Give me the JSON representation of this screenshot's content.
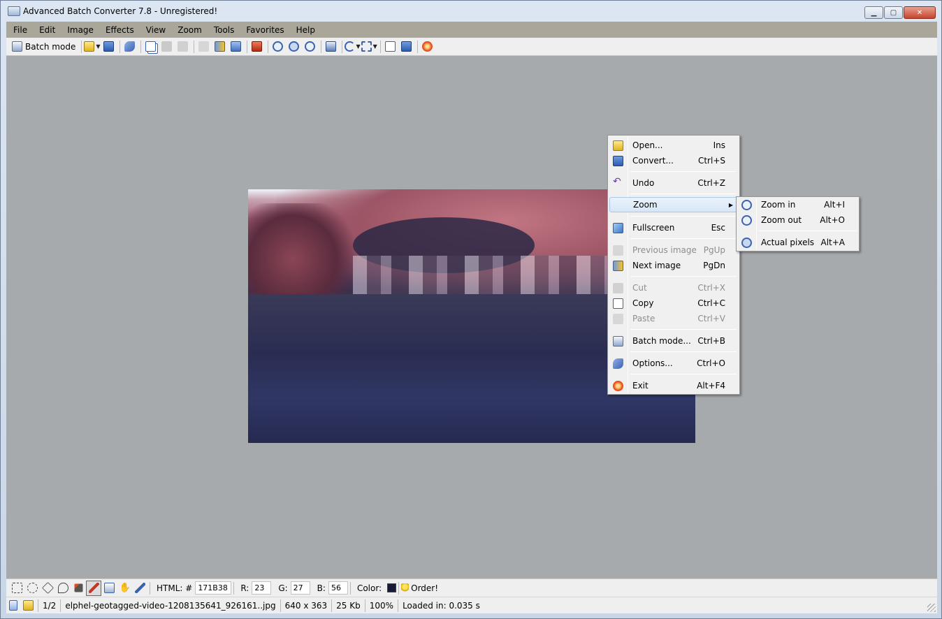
{
  "window": {
    "title": "Advanced Batch Converter 7.8 - Unregistered!"
  },
  "menubar": [
    "File",
    "Edit",
    "Image",
    "Effects",
    "View",
    "Zoom",
    "Tools",
    "Favorites",
    "Help"
  ],
  "toolbar": {
    "batch_label": "Batch mode"
  },
  "context_menu": {
    "items": [
      {
        "label": "Open...",
        "shortcut": "Ins"
      },
      {
        "label": "Convert...",
        "shortcut": "Ctrl+S"
      },
      {
        "label": "Undo",
        "shortcut": "Ctrl+Z"
      },
      {
        "label": "Zoom",
        "shortcut": ""
      },
      {
        "label": "Fullscreen",
        "shortcut": "Esc"
      },
      {
        "label": "Previous image",
        "shortcut": "PgUp"
      },
      {
        "label": "Next image",
        "shortcut": "PgDn"
      },
      {
        "label": "Cut",
        "shortcut": "Ctrl+X"
      },
      {
        "label": "Copy",
        "shortcut": "Ctrl+C"
      },
      {
        "label": "Paste",
        "shortcut": "Ctrl+V"
      },
      {
        "label": "Batch mode...",
        "shortcut": "Ctrl+B"
      },
      {
        "label": "Options...",
        "shortcut": "Ctrl+O"
      },
      {
        "label": "Exit",
        "shortcut": "Alt+F4"
      }
    ]
  },
  "zoom_submenu": {
    "items": [
      {
        "label": "Zoom in",
        "shortcut": "Alt+I"
      },
      {
        "label": "Zoom out",
        "shortcut": "Alt+O"
      },
      {
        "label": "Actual pixels",
        "shortcut": "Alt+A"
      }
    ]
  },
  "color_bar": {
    "html_label": "HTML: #",
    "html_value": "171B38",
    "r_label": "R:",
    "r_value": "23",
    "g_label": "G:",
    "g_value": "27",
    "b_label": "B:",
    "b_value": "56",
    "color_label": "Color:",
    "color_value": "#171b38",
    "order_label": "Order!"
  },
  "status": {
    "index": "1/2",
    "filename": "elphel-geotagged-video-1208135641_926161..jpg",
    "dimensions": "640 x 363",
    "size": "25 Kb",
    "zoom": "100%",
    "loaded": "Loaded in: 0.035 s"
  }
}
